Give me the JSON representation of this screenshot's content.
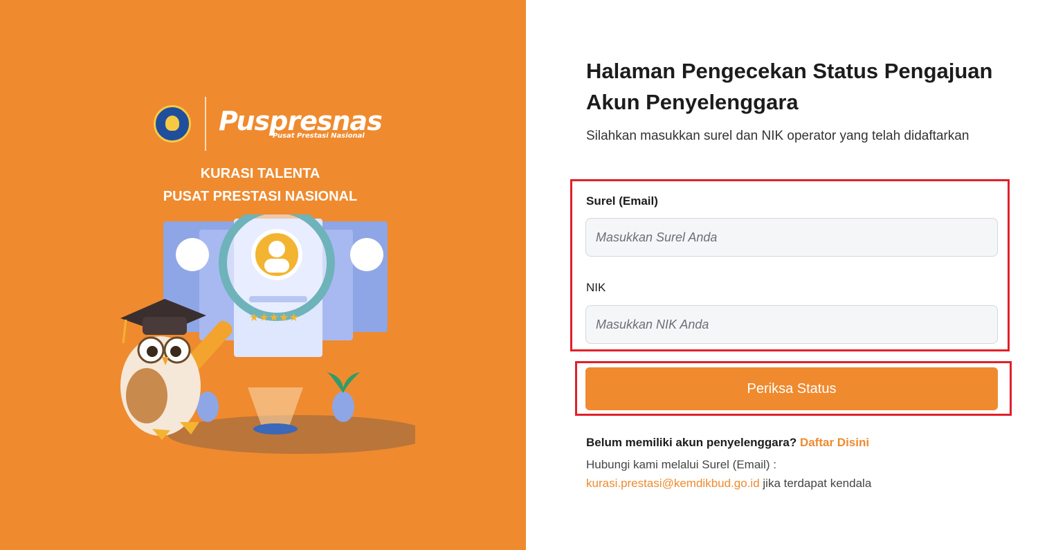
{
  "brand": {
    "name": "Puspresnas",
    "tagline": "Pusat Prestasi Nasional"
  },
  "left_panel": {
    "title_line1": "KURASI TALENTA",
    "title_line2": "PUSAT PRESTASI NASIONAL",
    "background_color": "#ef8a2e"
  },
  "main": {
    "heading": "Halaman Pengecekan Status Pengajuan Akun Penyelenggara",
    "description": "Silahkan masukkan surel dan NIK operator yang telah didaftarkan"
  },
  "form": {
    "email_label": "Surel (Email)",
    "email_placeholder": "Masukkan Surel Anda",
    "nik_label": "NIK",
    "nik_placeholder": "Masukkan NIK Anda",
    "submit_label": "Periksa Status"
  },
  "footer": {
    "question": "Belum memiliki akun penyelenggara?",
    "register_link": "Daftar Disini",
    "contact_prefix": "Hubungi kami melalui Surel (Email) :",
    "contact_email": "kurasi.prestasi@kemdikbud.go.id",
    "contact_suffix": "jika terdapat kendala"
  },
  "colors": {
    "accent": "#ef8a2e",
    "highlight_border": "#e01f2b"
  }
}
